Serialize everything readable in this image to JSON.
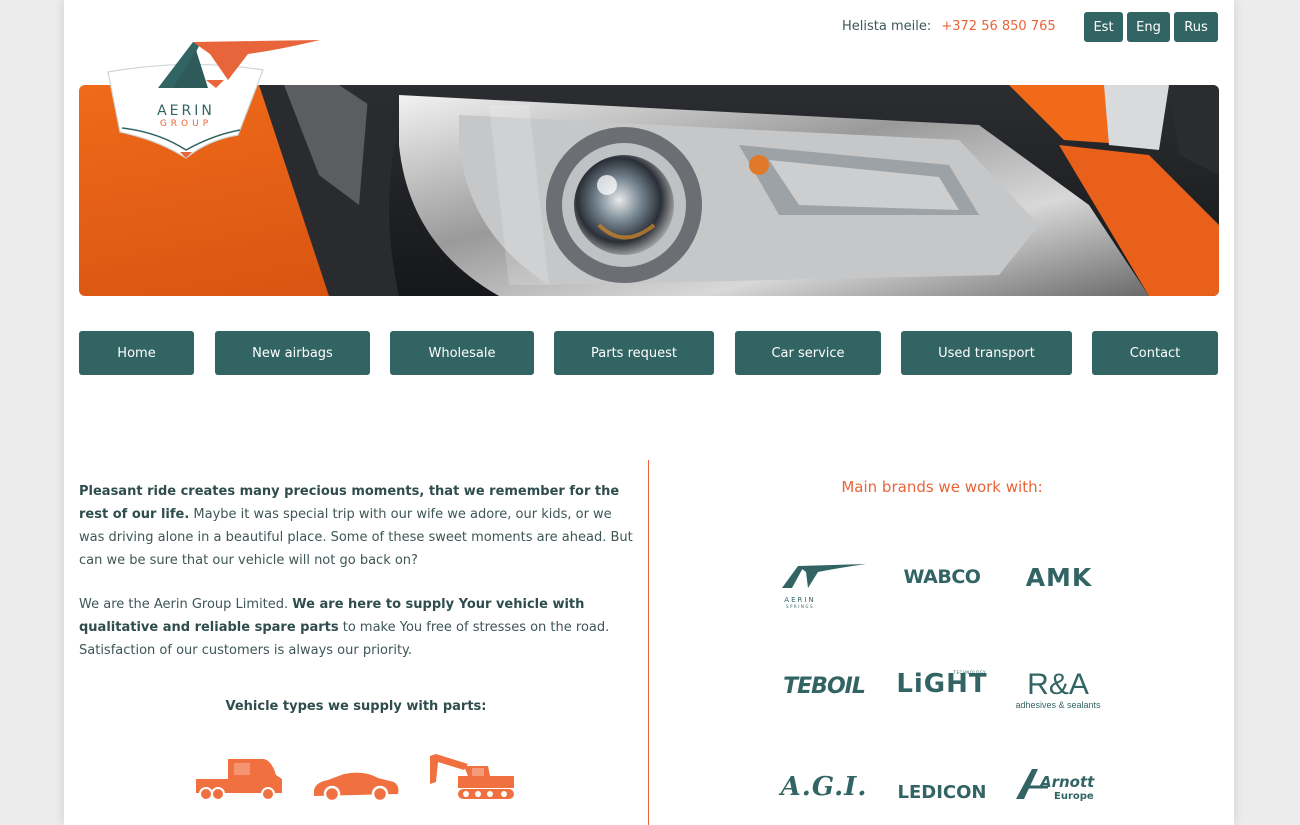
{
  "header": {
    "phone_label": "Helista meile:",
    "phone_number": "+372 56 850 765",
    "languages": [
      "Est",
      "Eng",
      "Rus"
    ]
  },
  "logo": {
    "line1": "AERIN",
    "line2": "GROUP"
  },
  "nav": [
    "Home",
    "New airbags",
    "Wholesale",
    "Parts request",
    "Car service",
    "Used transport",
    "Contact"
  ],
  "intro": {
    "p1_bold": "Pleasant ride creates many precious moments, that we remember for the rest of our life.",
    "p1_rest": " Maybe it was special trip with our wife we adore, our kids, or we was driving alone in a beautiful place. Some of these sweet moments are ahead. But can we be sure that our vehicle will not go back on?",
    "p2_a": "We are the Aerin Group Limited. ",
    "p2_bold": "We are here to supply Your vehicle with qualitative and reliable spare parts",
    "p2_c": " to make You free of stresses on the road. Satisfaction of our customers is always our priority."
  },
  "vehicle_types": {
    "title": "Vehicle types we supply with parts:",
    "icons": [
      "truck-icon",
      "car-icon",
      "excavator-icon"
    ]
  },
  "brands": {
    "title": "Main brands we work with:",
    "aerin": {
      "name": "AERIN",
      "sub": "SPRINGS"
    },
    "wabco": "WABCO",
    "amk": "AMK",
    "teboil": "TEBOIL",
    "light": "LiGHT",
    "light_sub": "TECHNOLOGY",
    "ra": "R&A",
    "ra_sub": "adhesives & sealants",
    "agi": "A.G.I.",
    "ledicon": "LEDICON",
    "arnott": "Arnott",
    "arnott_sub": "Europe"
  },
  "colors": {
    "primary": "#336464",
    "accent": "#e8643a",
    "text": "#3f5656"
  }
}
